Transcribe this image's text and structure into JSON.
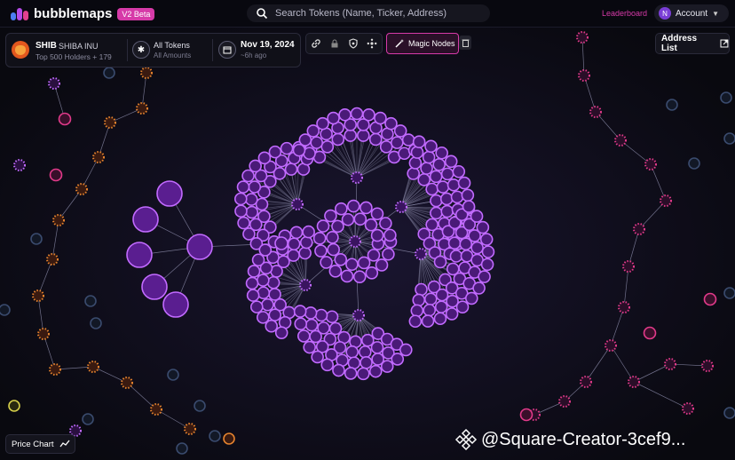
{
  "app": {
    "name": "bubblemaps",
    "badge": "V2 Beta"
  },
  "search": {
    "placeholder": "Search Tokens (Name, Ticker, Address)"
  },
  "nav": {
    "leaderboard": "Leaderboard",
    "account_label": "Account",
    "avatar_letter": "N"
  },
  "token": {
    "symbol": "SHIB",
    "name": "SHIBA INU",
    "holders_text": "Top 500 Holders + 179"
  },
  "filter": {
    "title": "All Tokens",
    "subtitle": "All Amounts"
  },
  "date": {
    "title": "Nov 19, 2024",
    "subtitle": "~6h ago"
  },
  "toolbar": {
    "magic_label": "Magic Nodes",
    "icons": [
      "link-icon",
      "lock-icon",
      "shield-icon",
      "cluster-icon"
    ]
  },
  "address_list": {
    "label": "Address List"
  },
  "price_chart": {
    "label": "Price Chart"
  },
  "watermark": {
    "text": "@Square-Creator-3cef9..."
  },
  "colors": {
    "accent": "#d63aa8",
    "node_purple": "#9b35e0",
    "node_border": "#c26bff",
    "node_orange": "#e5832e",
    "node_blue": "#3a4b6e",
    "node_pink": "#e23a8a",
    "edge": "#8a8aa8"
  }
}
